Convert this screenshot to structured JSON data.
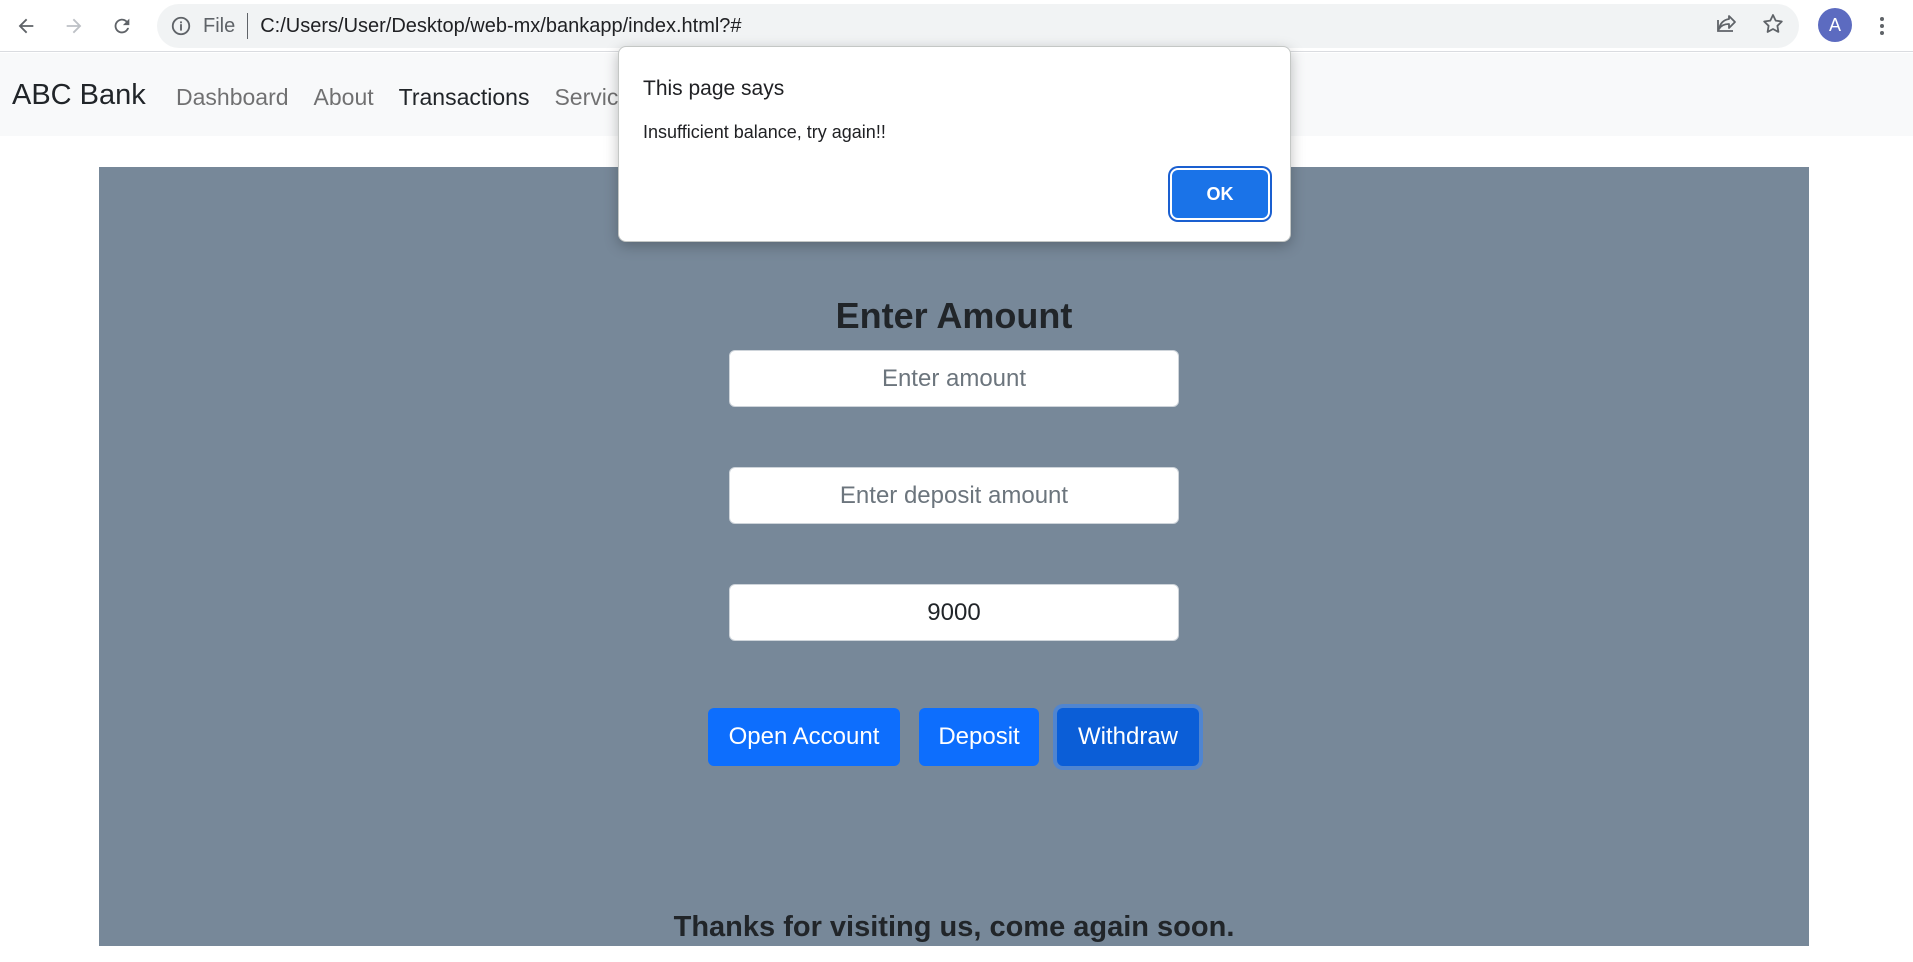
{
  "browser": {
    "file_label": "File",
    "url": "C:/Users/User/Desktop/web-mx/bankapp/index.html?#",
    "profile_initial": "A"
  },
  "navbar": {
    "brand": "ABC Bank",
    "links": [
      {
        "label": "Dashboard"
      },
      {
        "label": "About"
      },
      {
        "label": "Transactions"
      },
      {
        "label": "Servic"
      }
    ]
  },
  "form": {
    "title": "Enter Amount",
    "amount_placeholder": "Enter amount",
    "deposit_placeholder": "Enter deposit amount",
    "withdraw_value": "9000",
    "open_account_label": "Open Account",
    "deposit_label": "Deposit",
    "withdraw_label": "Withdraw"
  },
  "footer": {
    "message": "Thanks for visiting us, come again soon."
  },
  "dialog": {
    "title": "This page says",
    "message": "Insufficient balance, try again!!",
    "ok_label": "OK"
  },
  "colors": {
    "panel_bg": "#778899",
    "primary": "#0d6efd",
    "dialog_ok": "#1a73e8"
  }
}
